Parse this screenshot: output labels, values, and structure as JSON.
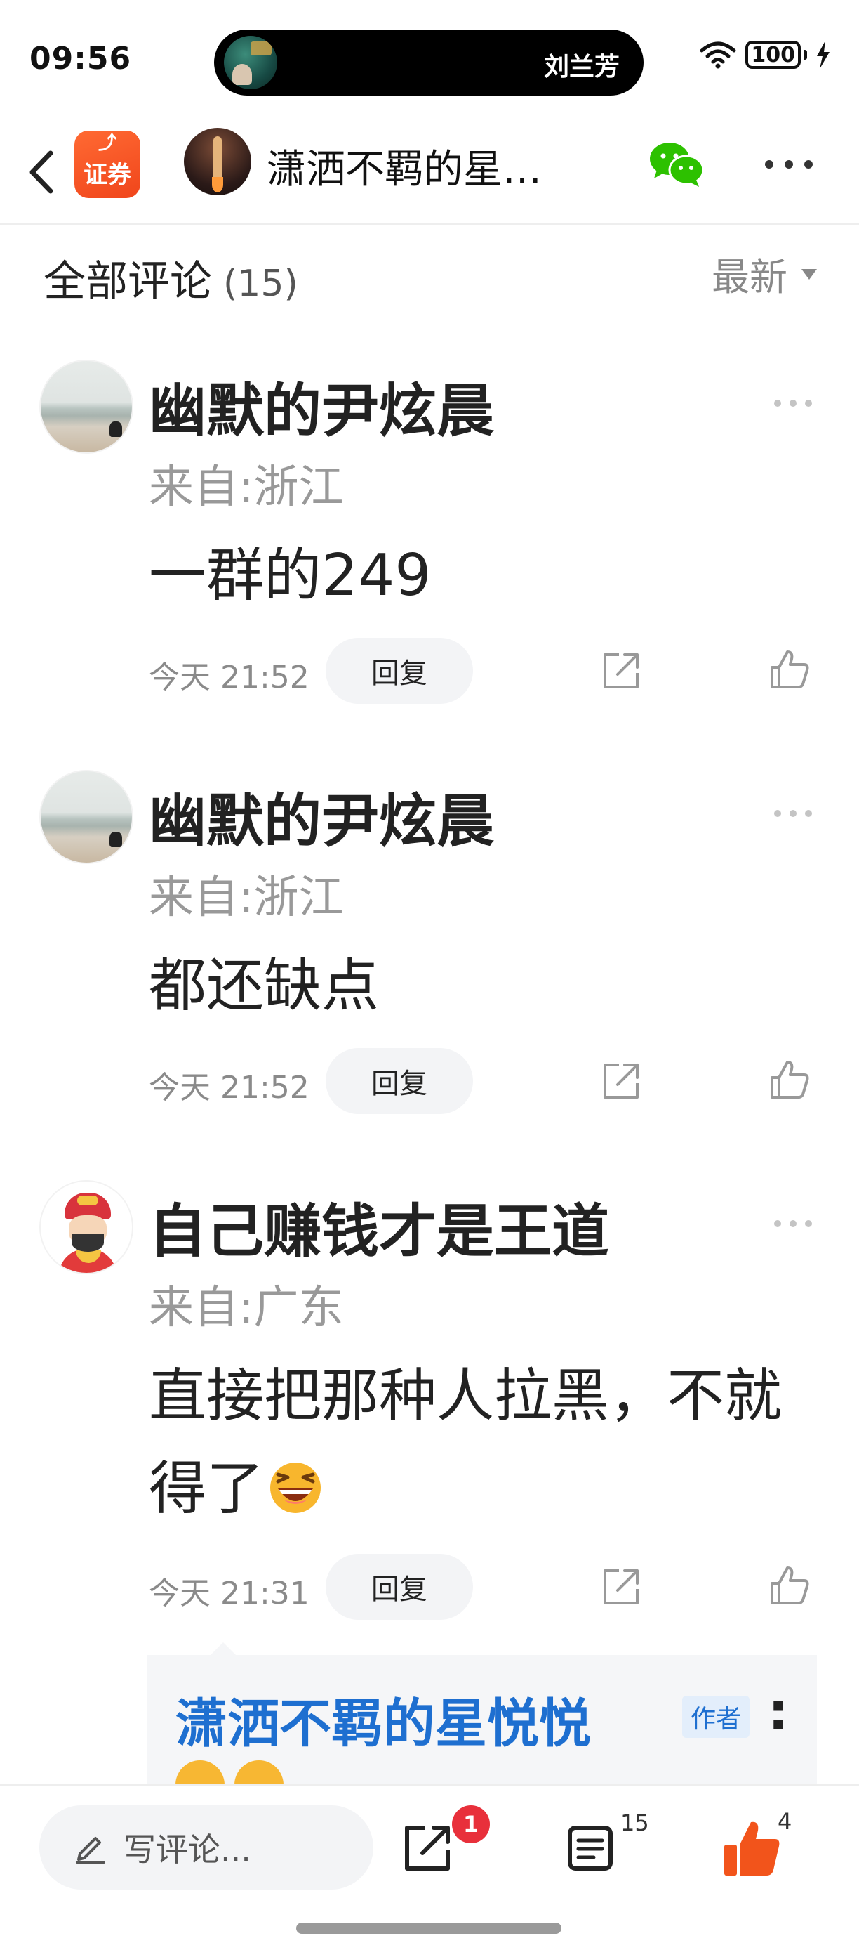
{
  "status_bar": {
    "time": "09:56",
    "island_title": "刘兰芳",
    "battery": "100"
  },
  "header": {
    "app_logo_text": "证券",
    "author_name": "潇洒不羁的星…"
  },
  "comments_section": {
    "title": "全部评论",
    "count": "(15)",
    "sort_label": "最新"
  },
  "comments": [
    {
      "name": "幽默的尹炫晨",
      "location": "来自:浙江",
      "text": "一群的249",
      "time": "今天 21:52",
      "reply_label": "回复"
    },
    {
      "name": "幽默的尹炫晨",
      "location": "来自:浙江",
      "text": "都还缺点",
      "time": "今天 21:52",
      "reply_label": "回复"
    },
    {
      "name": "自己赚钱才是王道",
      "location": "来自:广东",
      "text": "直接把那种人拉黑，不就得了",
      "time": "今天 21:31",
      "reply_label": "回复"
    }
  ],
  "reply_preview": {
    "author": "潇洒不羁的星悦悦",
    "badge": "作者",
    "colon": ":"
  },
  "bottom_bar": {
    "write_placeholder": "写评论...",
    "share_badge": "1",
    "comment_count": "15",
    "like_count": "4"
  },
  "colors": {
    "accent_orange": "#f2541b",
    "link_blue": "#1e6fd0",
    "badge_red": "#e8303b",
    "wechat_green": "#2dc100"
  }
}
